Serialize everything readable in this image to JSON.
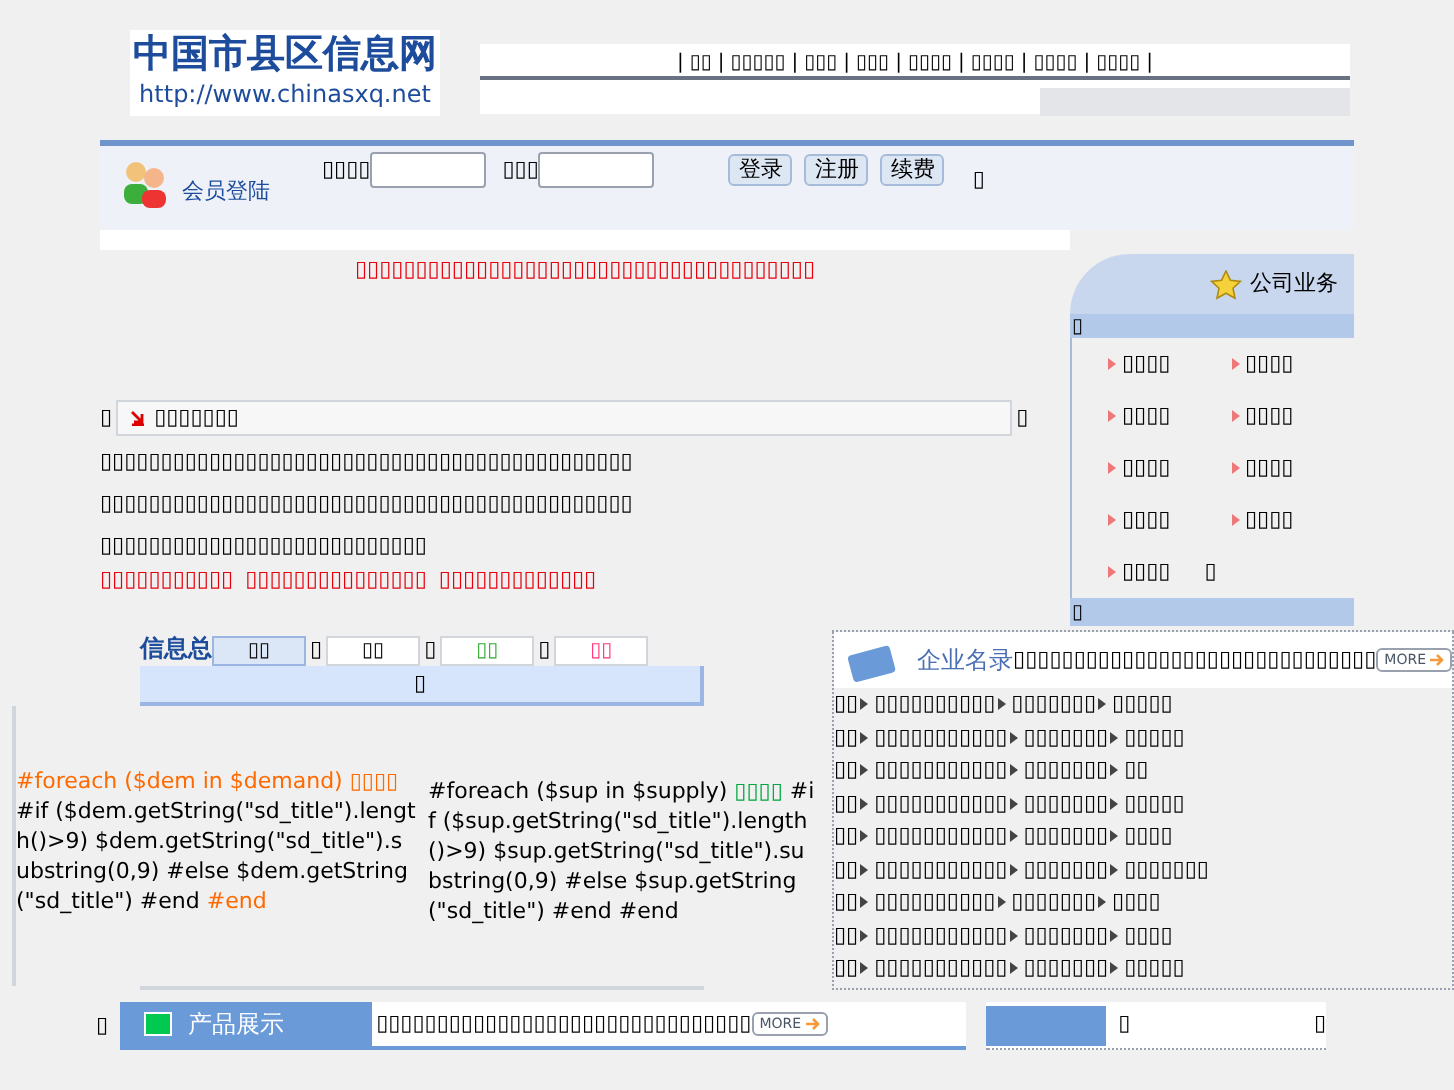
{
  "logo": {
    "title": "中国市县区信息网",
    "url": "http://www.chinasxq.net"
  },
  "nav_separator": "|",
  "nav": [
    "▯▯",
    "▯▯▯▯▯",
    "▯▯▯",
    "▯▯▯",
    "▯▯▯▯",
    "▯▯▯▯",
    "▯▯▯▯",
    "▯▯▯▯"
  ],
  "login": {
    "title": "会员登陆",
    "fields": [
      {
        "label": "▯▯▯▯"
      },
      {
        "label": "▯▯▯"
      }
    ],
    "buttons": [
      "登录",
      "注册",
      "续费"
    ],
    "trailing": "▯"
  },
  "notice": "▯▯▯▯▯▯▯▯▯▯▯▯▯▯▯▯▯▯▯▯▯▯▯▯▯▯▯▯▯▯▯▯▯▯▯▯▯▯",
  "business": {
    "title": "公司业务",
    "top": "▯",
    "items": [
      "▯▯▯▯",
      "▯▯▯▯",
      "▯▯▯▯",
      "▯▯▯▯",
      "▯▯▯▯",
      "▯▯▯▯",
      "▯▯▯▯",
      "▯▯▯▯",
      "▯▯▯▯"
    ],
    "trailing": "▯",
    "bottom": "▯"
  },
  "news": {
    "left": "▯",
    "title": "▯▯▯▯▯▯▯",
    "right": "▯",
    "paragraph": "▯▯▯▯▯▯▯▯▯▯▯▯▯▯▯▯▯▯▯▯▯▯▯▯▯▯▯▯▯▯▯▯▯▯▯▯▯▯▯▯▯▯▯▯▯▯▯▯▯▯▯▯▯▯▯▯▯▯▯▯▯▯▯▯▯▯▯▯▯▯▯▯▯▯▯▯▯▯▯▯▯▯▯▯▯▯▯▯▯▯▯▯▯▯▯▯▯▯▯▯▯▯▯▯▯▯▯▯▯▯▯▯▯▯▯",
    "red": [
      "▯▯▯▯▯▯▯▯▯▯▯",
      "▯▯▯▯▯▯▯▯▯▯▯▯▯▯▯",
      "▯▯▯▯▯▯▯▯▯▯▯▯▯"
    ]
  },
  "info": {
    "title": "信息总",
    "tabs": [
      {
        "label": "▯▯",
        "selected": true,
        "color": "#000000"
      },
      {
        "label": "▯▯",
        "selected": false,
        "color": "#000000"
      },
      {
        "label": "▯▯",
        "selected": false,
        "color": "#33aa33"
      },
      {
        "label": "▯▯",
        "selected": false,
        "color": "#ff3377"
      }
    ],
    "separator": "▯",
    "panel": "▯",
    "demand": {
      "head": "#foreach ($dem in $demand)",
      "tag": "▯▯▯▯",
      "body": "#if ($dem.getString(\"sd_title\").length()>9) $dem.getString(\"sd_title\").substring(0,9) #else $dem.getString(\"sd_title\") #end",
      "tail": "#end"
    },
    "supply": {
      "head": "#foreach ($sup in $supply)",
      "tag": "▯▯▯▯",
      "body": "#if ($sup.getString(\"sd_title\").length()>9) $sup.getString(\"sd_title\").substring(0,9) #else $sup.getString(\"sd_title\") #end",
      "tail": "#end"
    }
  },
  "companies": {
    "title": "企业名录",
    "marquee": "▯▯▯▯▯▯▯▯▯▯▯▯▯▯▯▯▯▯▯▯▯▯▯▯▯▯▯▯▯▯",
    "more": "MORE",
    "rows": [
      [
        "▯▯",
        "▯▯▯▯▯▯▯▯▯▯",
        "▯▯▯▯▯▯▯",
        "▯▯▯▯▯"
      ],
      [
        "▯▯",
        "▯▯▯▯▯▯▯▯▯▯▯",
        "▯▯▯▯▯▯▯",
        "▯▯▯▯▯"
      ],
      [
        "▯▯",
        "▯▯▯▯▯▯▯▯▯▯▯",
        "▯▯▯▯▯▯▯",
        "▯▯"
      ],
      [
        "▯▯",
        "▯▯▯▯▯▯▯▯▯▯▯",
        "▯▯▯▯▯▯▯",
        "▯▯▯▯▯"
      ],
      [
        "▯▯",
        "▯▯▯▯▯▯▯▯▯▯▯",
        "▯▯▯▯▯▯▯",
        "▯▯▯▯"
      ],
      [
        "▯▯",
        "▯▯▯▯▯▯▯▯▯▯▯",
        "▯▯▯▯▯▯▯",
        "▯▯▯▯▯▯▯"
      ],
      [
        "▯▯",
        "▯▯▯▯▯▯▯▯▯▯",
        "▯▯▯▯▯▯▯",
        "▯▯▯▯"
      ],
      [
        "▯▯",
        "▯▯▯▯▯▯▯▯▯▯▯",
        "▯▯▯▯▯▯▯",
        "▯▯▯▯"
      ],
      [
        "▯▯",
        "▯▯▯▯▯▯▯▯▯▯▯",
        "▯▯▯▯▯▯▯",
        "▯▯▯▯▯"
      ]
    ]
  },
  "products": {
    "left": "▯",
    "title": "产品展示",
    "marquee": "▯▯▯▯▯▯▯▯▯▯▯▯▯▯▯▯▯▯▯▯▯▯▯▯▯▯▯▯▯▯▯",
    "more": "MORE",
    "side": [
      "▯",
      "▯"
    ]
  }
}
